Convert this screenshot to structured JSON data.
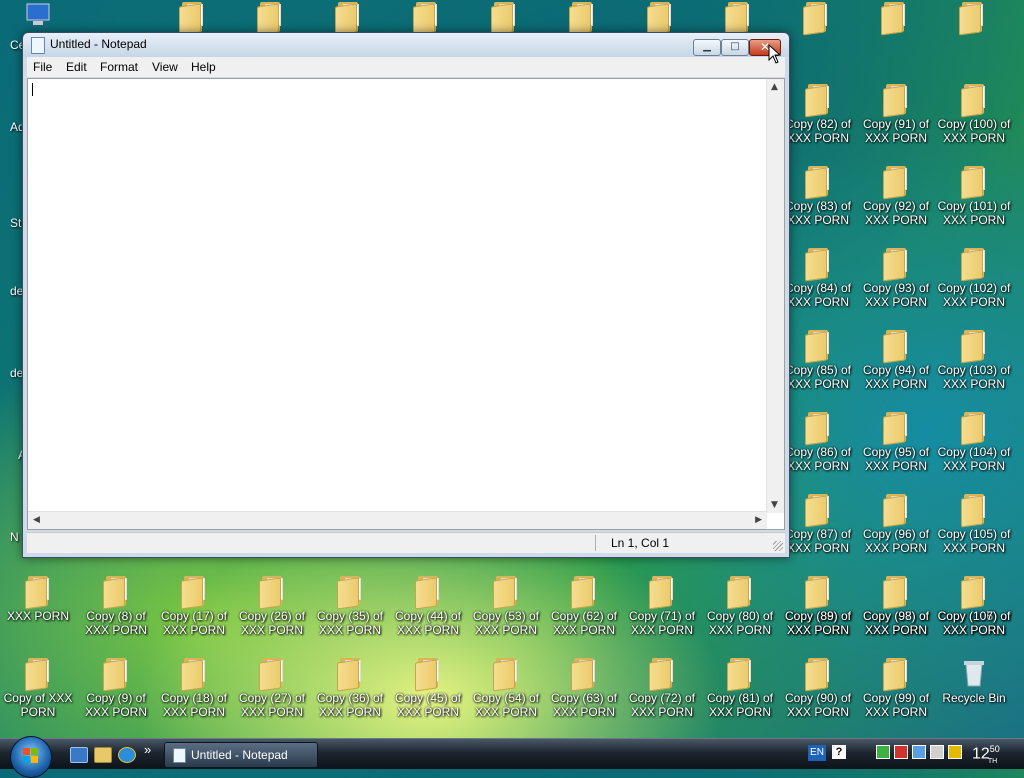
{
  "desktop": {
    "edge_labels": [
      "Ce",
      "Ado",
      "St",
      "de",
      "de",
      "A",
      "N"
    ],
    "top_row_icons": [
      "",
      "",
      "",
      "",
      "",
      "",
      "",
      "",
      "",
      "",
      "",
      "",
      ""
    ],
    "right_columns": [
      [
        "Copy (82) of XXX PORN",
        "Copy (83) of XXX PORN",
        "Copy (84) of XXX PORN",
        "Copy (85) of XXX PORN",
        "Copy (86) of XXX PORN",
        "Copy (87) of XXX PORN",
        "Copy (88) of XXX PORN"
      ],
      [
        "Copy (91) of XXX PORN",
        "Copy (92) of XXX PORN",
        "Copy (93) of XXX PORN",
        "Copy (94) of XXX PORN",
        "Copy (95) of XXX PORN",
        "Copy (96) of XXX PORN",
        "Copy (97) of XXX PORN"
      ],
      [
        "Copy (100) of XXX PORN",
        "Copy (101) of XXX PORN",
        "Copy (102) of XXX PORN",
        "Copy (103) of XXX PORN",
        "Copy (104) of XXX PORN",
        "Copy (105) of XXX PORN",
        "Copy (106) of XXX PORN"
      ]
    ],
    "row_a": [
      "XXX PORN",
      "Copy (8) of XXX PORN",
      "Copy (17) of XXX PORN",
      "Copy (26) of XXX PORN",
      "Copy (35) of XXX PORN",
      "Copy (44) of XXX PORN",
      "Copy (53) of XXX PORN",
      "Copy (62) of XXX PORN",
      "Copy (71) of XXX PORN",
      "Copy (80) of XXX PORN",
      "Copy (89) of XXX PORN",
      "Copy (98) of XXX PORN",
      "Copy (107) of XXX PORN"
    ],
    "row_b": [
      "Copy of XXX PORN",
      "Copy (9) of XXX PORN",
      "Copy (18) of XXX PORN",
      "Copy (27) of XXX PORN",
      "Copy (36) of XXX PORN",
      "Copy (45) of XXX PORN",
      "Copy (54) of XXX PORN",
      "Copy (63) of XXX PORN",
      "Copy (72) of XXX PORN",
      "Copy (81) of XXX PORN",
      "Copy (90) of XXX PORN",
      "Copy (99) of XXX PORN",
      "Recycle Bin"
    ]
  },
  "notepad": {
    "title": "Untitled - Notepad",
    "menu": [
      "File",
      "Edit",
      "Format",
      "View",
      "Help"
    ],
    "content": "",
    "status": "Ln 1, Col 1",
    "buttons": {
      "minimize": "▁",
      "maximize": "□",
      "close": "✕"
    }
  },
  "taskbar": {
    "task_label": "Untitled - Notepad",
    "quicklaunch_more": "»",
    "lang": "EN",
    "help": "?",
    "clock_hour": "12",
    "clock_min": "50",
    "clock_suffix": "TH"
  },
  "colors": {
    "accent": "#1d63b8",
    "close_red": "#c4391c",
    "folder": "#eccb6c"
  }
}
